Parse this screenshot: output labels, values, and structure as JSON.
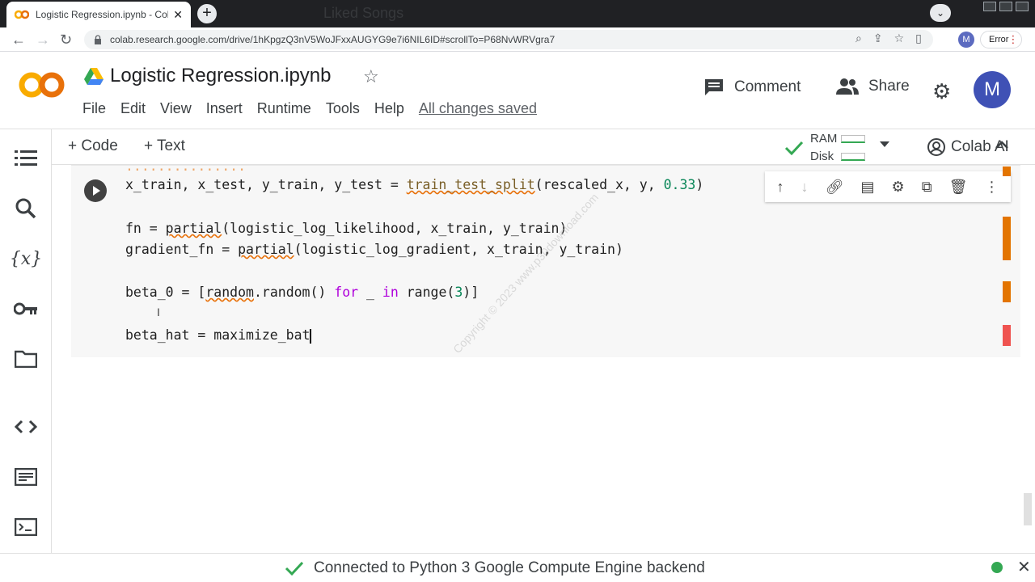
{
  "browser": {
    "tab_title": "Logistic Regression.ipynb - Colab",
    "tab_close": "✕",
    "new_tab": "+",
    "background_tab": "Liked Songs",
    "url": "colab.research.google.com/drive/1hKpgzQ3nV5WoJFxxAUGYG9e7i6NIL6ID#scrollTo=P68NvWRVgra7",
    "profile_letter": "M",
    "error_label": "Error"
  },
  "header": {
    "logo": "CO",
    "title": "Logistic Regression.ipynb",
    "menu": [
      "File",
      "Edit",
      "View",
      "Insert",
      "Runtime",
      "Tools",
      "Help"
    ],
    "saved_status": "All changes saved",
    "comment_label": "Comment",
    "share_label": "Share",
    "avatar_letter": "M"
  },
  "notebook_toolbar": {
    "add_code": "+ Code",
    "add_text": "+ Text",
    "ram_label": "RAM",
    "disk_label": "Disk",
    "colab_ai": "Colab AI"
  },
  "cell": {
    "partial_top": "...............",
    "line1_a": "x_train, x_test, y_train, y_test = ",
    "line1_fn": "train_test_split",
    "line1_b": "(rescaled_x, y, ",
    "line1_num": "0.33",
    "line1_c": ")",
    "line2_a": "fn = ",
    "line2_fn": "partial",
    "line2_b": "(logistic_log_likelihood, x_train, y_train)",
    "line3_a": "gradient_fn = ",
    "line3_fn": "partial",
    "line3_b": "(logistic_log_gradient, x_train, y_train)",
    "line4_a": "beta_0 = [",
    "line4_fn": "random",
    "line4_b": ".random() ",
    "line4_kw1": "for",
    "line4_c": " _ ",
    "line4_kw2": "in",
    "line4_d": " range(",
    "line4_num": "3",
    "line4_e": ")]",
    "line5": "beta_hat = maximize_bat"
  },
  "watermark": "Copyright © 2023 www.p30download.com",
  "status": {
    "message": "Connected to Python 3 Google Compute Engine backend"
  },
  "colors": {
    "accent_orange": "#f9ab00",
    "marker_orange": "#e37400",
    "marker_red": "#ef5350",
    "check_green": "#34a853"
  }
}
